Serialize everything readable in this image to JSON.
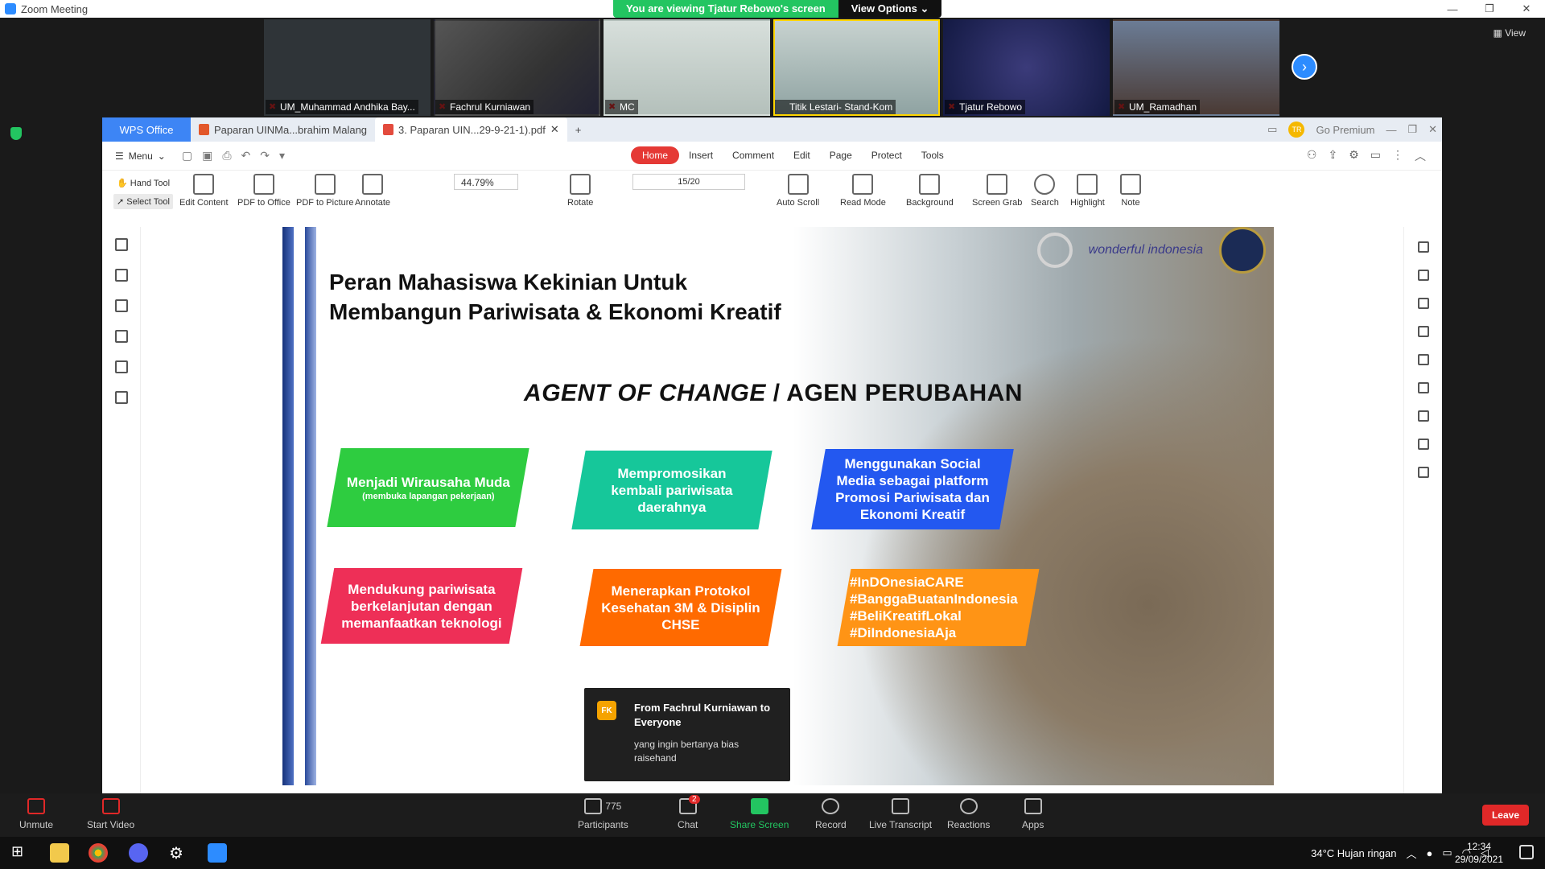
{
  "window": {
    "title": "Zoom Meeting"
  },
  "banner": {
    "message": "You are viewing Tjatur Rebowo's screen",
    "options": "View Options ⌄"
  },
  "view_label": "View",
  "participants_tiles": [
    {
      "name": "UM_Muhammad Andhika Bay...",
      "bg": "#2f3438"
    },
    {
      "name": "Fachrul Kurniawan",
      "bg": "#3e4046"
    },
    {
      "name": "MC",
      "bg": "#bfcbc7"
    },
    {
      "name": "Titik Lestari- Stand-Kom",
      "bg": "#9fb0b2"
    },
    {
      "name": "Tjatur Rebowo",
      "bg": "#2a2f6a"
    },
    {
      "name": "UM_Ramadhan",
      "bg": "#5a4b46"
    }
  ],
  "wps": {
    "brand": "WPS Office",
    "tabs": [
      "Paparan UINMa...brahim Malang",
      "3. Paparan UIN...29-9-21-1).pdf"
    ],
    "premium": "Go Premium",
    "menu": "Menu",
    "ribbon_tabs": [
      "Home",
      "Insert",
      "Comment",
      "Edit",
      "Page",
      "Protect",
      "Tools"
    ],
    "hand_tool": "Hand Tool",
    "select_tool": "Select Tool",
    "zoom": "44.79%",
    "page": "15/20",
    "tools": [
      "Edit Content",
      "PDF to Office",
      "PDF to Picture",
      "Annotate",
      "Rotate",
      "Auto Scroll",
      "Read Mode",
      "Background",
      "Screen Grab",
      "Search",
      "Highlight",
      "Note"
    ]
  },
  "slide": {
    "title_line1": "Peran Mahasiswa Kekinian Untuk",
    "title_line2": "Membangun  Pariwisata & Ekonomi Kreatif",
    "agent_en": "AGENT OF CHANGE",
    "agent_sep": " / ",
    "agent_id": "AGEN  PERUBAHAN",
    "logo_text": "wonderful indonesia",
    "cards": [
      {
        "text": "Menjadi Wirausaha Muda",
        "sub": "(membuka lapangan pekerjaan)",
        "color": "#2ecc40"
      },
      {
        "text": "Mempromosikan kembali pariwisata daerahnya",
        "sub": "",
        "color": "#16c79a"
      },
      {
        "text": "Menggunakan Social Media sebagai platform Promosi Pariwisata dan Ekonomi Kreatif",
        "sub": "",
        "color": "#2358f0"
      },
      {
        "text": "Mendukung pariwisata berkelanjutan dengan memanfaatkan teknologi",
        "sub": "",
        "color": "#ee2f57"
      },
      {
        "text": "Menerapkan Protokol Kesehatan 3M & Disiplin CHSE",
        "sub": "",
        "color": "#ff6a00"
      },
      {
        "text": "#InDOnesiaCARE #BanggaBuatanIndonesia #BeliKreatifLokal #DiIndonesiaAja",
        "sub": "",
        "color": "#ff9415"
      }
    ]
  },
  "chat_toast": {
    "initials": "FK",
    "from": "From Fachrul Kurniawan to Everyone",
    "message": "yang ingin bertanya bias raisehand"
  },
  "controls": {
    "unmute": "Unmute",
    "start_video": "Start Video",
    "participants": "Participants",
    "participant_count": "775",
    "chat": "Chat",
    "chat_badge": "2",
    "share": "Share Screen",
    "record": "Record",
    "transcript": "Live Transcript",
    "reactions": "Reactions",
    "apps": "Apps",
    "leave": "Leave"
  },
  "taskbar": {
    "weather": "34°C  Hujan ringan",
    "time": "12:34",
    "date": "29/09/2021"
  }
}
